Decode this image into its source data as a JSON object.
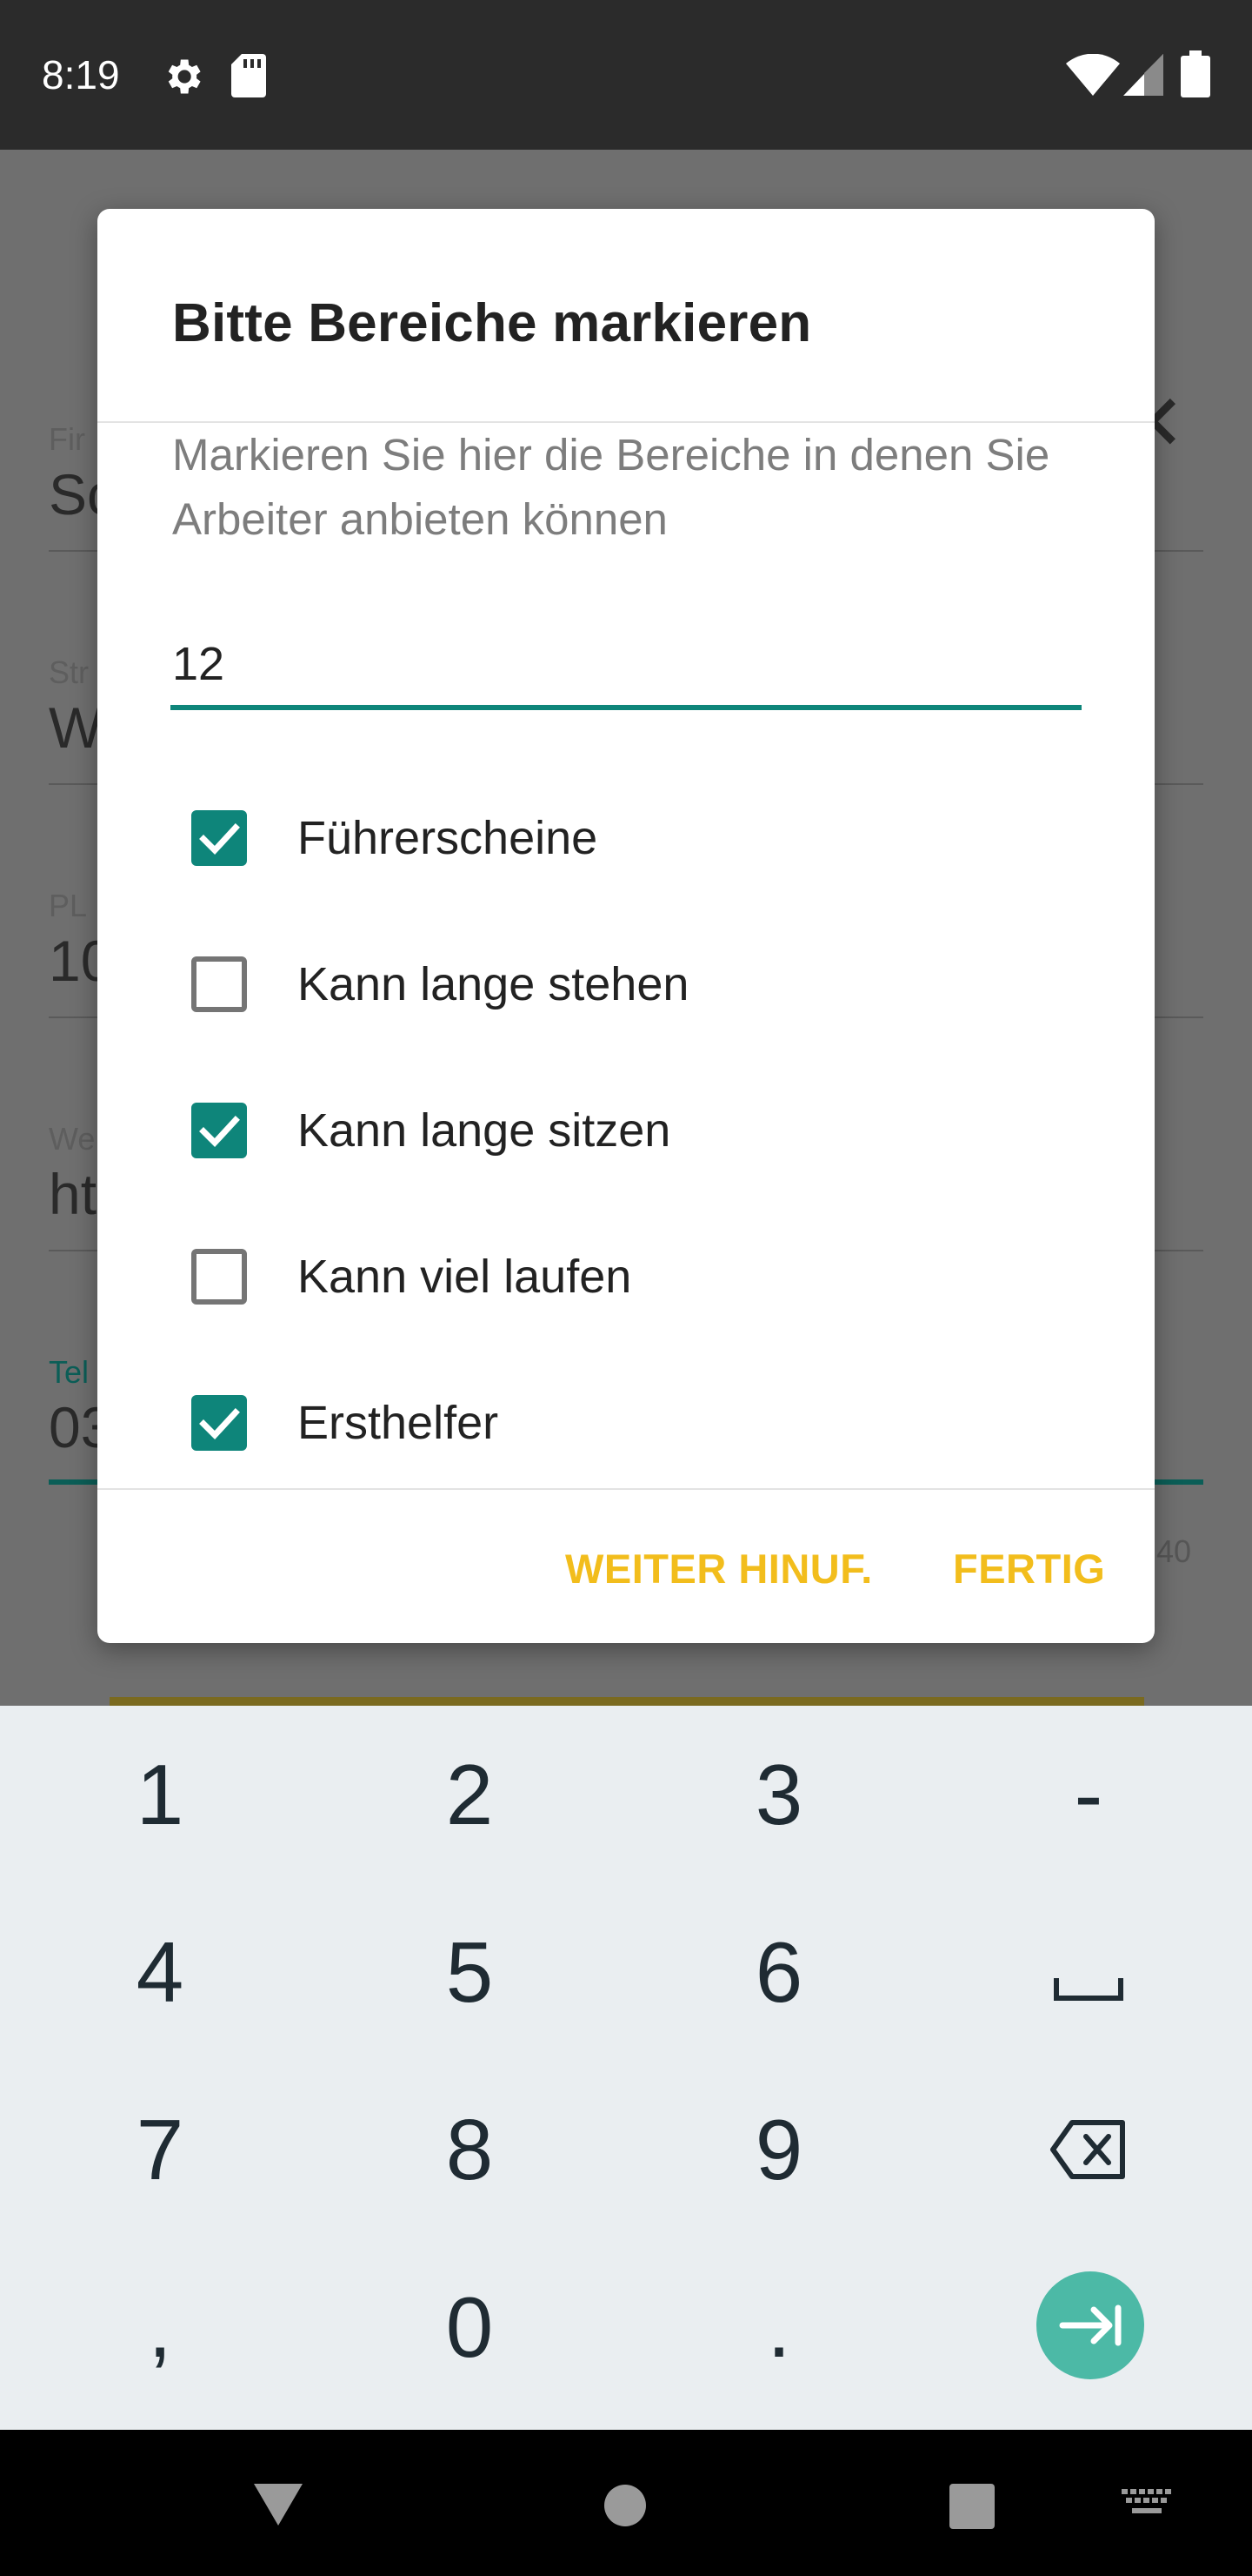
{
  "status_bar": {
    "time": "8:19",
    "icons": [
      "gear-icon",
      "sd-card-icon",
      "wifi-icon",
      "signal-icon",
      "battery-icon"
    ]
  },
  "background_form": {
    "fields": [
      {
        "label": "Fir",
        "value": "Sc"
      },
      {
        "label": "Str",
        "value": "W"
      },
      {
        "label": "PL",
        "value": "10"
      },
      {
        "label": "We",
        "value": "ht"
      },
      {
        "label": "Tel",
        "value": "03"
      }
    ],
    "counter": "40"
  },
  "dialog": {
    "title": "Bitte Bereiche markieren",
    "description": "Markieren Sie hier die Bereiche in denen Sie Arbeiter anbieten können",
    "input_value": "12",
    "options": [
      {
        "label": "Führerscheine",
        "checked": true
      },
      {
        "label": "Kann lange stehen",
        "checked": false
      },
      {
        "label": "Kann lange sitzen",
        "checked": true
      },
      {
        "label": "Kann viel laufen",
        "checked": false
      },
      {
        "label": "Ersthelfer",
        "checked": true
      }
    ],
    "buttons": {
      "secondary": "WEITER HINUF.",
      "primary": "FERTIG"
    }
  },
  "keyboard": {
    "keys": [
      "1",
      "2",
      "3",
      "-",
      "4",
      "5",
      "6",
      "space",
      "7",
      "8",
      "9",
      "backspace",
      ",",
      "0",
      ".",
      "next"
    ]
  },
  "colors": {
    "accent": "#0e857a",
    "button_text": "#f2bd1c",
    "enter_key": "#4cb9a6"
  }
}
